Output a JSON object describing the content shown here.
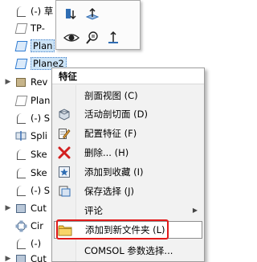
{
  "tree": {
    "items": [
      {
        "label": "(-) 草",
        "icon": "sketch-icon",
        "arrow": "",
        "selected": false
      },
      {
        "label": "TP-",
        "icon": "plane-icon",
        "arrow": "",
        "selected": false
      },
      {
        "label": "Plan",
        "icon": "plane-icon",
        "arrow": "",
        "selected": true
      },
      {
        "label": "Plane2",
        "icon": "plane-icon",
        "arrow": "",
        "selected": true
      },
      {
        "label": "Rev",
        "icon": "revolve-icon",
        "arrow": "▶",
        "selected": false
      },
      {
        "label": "Plan",
        "icon": "plane-icon",
        "arrow": "",
        "selected": false
      },
      {
        "label": "(-) S",
        "icon": "sketch-icon",
        "arrow": "",
        "selected": false
      },
      {
        "label": "Spli",
        "icon": "split-icon",
        "arrow": "",
        "selected": false
      },
      {
        "label": "Ske",
        "icon": "sketch-icon",
        "arrow": "",
        "selected": false
      },
      {
        "label": "Ske",
        "icon": "sketch-icon",
        "arrow": "",
        "selected": false
      },
      {
        "label": "(-) S",
        "icon": "sketch-icon",
        "arrow": "",
        "selected": false
      },
      {
        "label": "Cut",
        "icon": "cut-icon",
        "arrow": "▶",
        "selected": false
      },
      {
        "label": "Cir",
        "icon": "circular-pattern-icon",
        "arrow": "",
        "selected": false
      },
      {
        "label": "(-)",
        "icon": "sketch-icon",
        "arrow": "",
        "selected": false
      },
      {
        "label": "Cut",
        "icon": "cut-icon",
        "arrow": "▶",
        "selected": false
      }
    ]
  },
  "toolbar": {
    "buttons": [
      {
        "name": "normal-to-icon"
      },
      {
        "name": "plane-view-icon"
      },
      {
        "name": "eye-icon"
      },
      {
        "name": "zoom-selection-icon"
      },
      {
        "name": "axis-icon"
      }
    ]
  },
  "menu": {
    "header": "特征",
    "items": [
      {
        "label": "剖面视图 (C)",
        "icon": "",
        "submenu": false
      },
      {
        "label": "活动剖切面 (D)",
        "icon": "section-plane-icon",
        "submenu": false
      },
      {
        "label": "配置特征 (F)",
        "icon": "configure-feature-icon",
        "submenu": false
      },
      {
        "label": "删除... (H)",
        "icon": "delete-icon",
        "submenu": false
      },
      {
        "label": "添加到收藏 (I)",
        "icon": "favorite-icon",
        "submenu": false
      },
      {
        "label": "保存选择 (J)",
        "icon": "save-selection-icon",
        "submenu": false
      },
      {
        "label": "评论",
        "icon": "",
        "submenu": true
      },
      {
        "label": "添加到新文件夹 (L)",
        "icon": "folder-icon",
        "submenu": false,
        "highlight": true
      },
      {
        "label": "COMSOL 参数选择...",
        "icon": "",
        "submenu": false
      }
    ]
  },
  "colors": {
    "highlight_box": "#e21b1b",
    "folder": "#f5c542",
    "delete": "#d21f1f",
    "selection": "#cce4f7"
  }
}
